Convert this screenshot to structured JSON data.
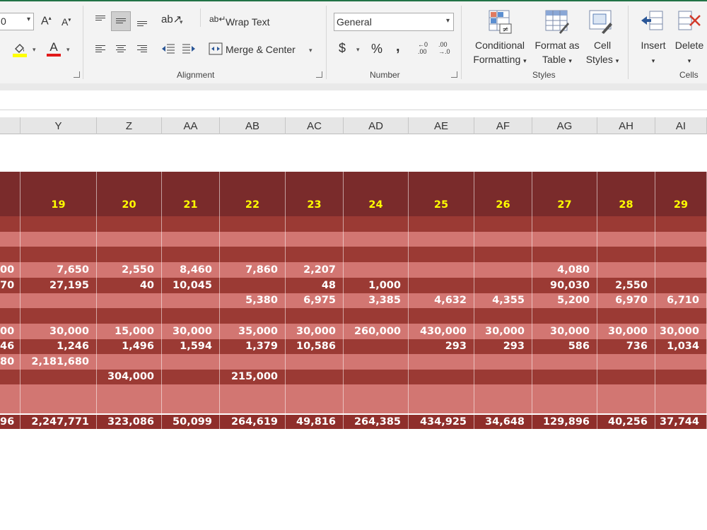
{
  "ribbon": {
    "font_size_value": "0",
    "wrap_text_label": "Wrap Text",
    "merge_center_label": "Merge & Center",
    "number_format_value": "General",
    "groups": {
      "alignment": "Alignment",
      "number": "Number",
      "styles": "Styles",
      "cells": "Cells"
    },
    "buttons": {
      "conditional_line1": "Conditional",
      "conditional_line2": "Formatting",
      "format_table_line1": "Format as",
      "format_table_line2": "Table",
      "cell_styles_line1": "Cell",
      "cell_styles_line2": "Styles",
      "insert": "Insert",
      "delete": "Delete"
    },
    "icons": {
      "grow_font": "A",
      "shrink_font": "A",
      "currency": "$",
      "percent": "%",
      "comma": ",",
      "increase_decimal_top": "←0",
      "increase_decimal_bottom": ".00",
      "decrease_decimal_top": ".00",
      "decrease_decimal_bottom": "→.0",
      "font_color": "A"
    }
  },
  "sheet": {
    "columns": [
      "Y",
      "Z",
      "AA",
      "AB",
      "AC",
      "AD",
      "AE",
      "AF",
      "AG",
      "AH",
      "AI"
    ],
    "header_days": [
      "",
      "19",
      "20",
      "21",
      "22",
      "23",
      "24",
      "25",
      "26",
      "27",
      "28",
      "29"
    ],
    "rows": [
      [
        "",
        "",
        "",
        "",
        "",
        "",
        "",
        "",
        "",
        "",
        "",
        ""
      ],
      [
        "",
        "",
        "",
        "",
        "",
        "",
        "",
        "",
        "",
        "",
        "",
        ""
      ],
      [
        "",
        "",
        "",
        "",
        "",
        "",
        "",
        "",
        "",
        "",
        "",
        ""
      ],
      [
        "00",
        "7,650",
        "2,550",
        "8,460",
        "7,860",
        "2,207",
        "",
        "",
        "",
        "4,080",
        "",
        ""
      ],
      [
        "70",
        "27,195",
        "40",
        "10,045",
        "",
        "48",
        "1,000",
        "",
        "",
        "90,030",
        "2,550",
        ""
      ],
      [
        "",
        "",
        "",
        "",
        "5,380",
        "6,975",
        "3,385",
        "4,632",
        "4,355",
        "5,200",
        "6,970",
        "6,710"
      ],
      [
        "",
        "",
        "",
        "",
        "",
        "",
        "",
        "",
        "",
        "",
        "",
        ""
      ],
      [
        "00",
        "30,000",
        "15,000",
        "30,000",
        "35,000",
        "30,000",
        "260,000",
        "430,000",
        "30,000",
        "30,000",
        "30,000",
        "30,000"
      ],
      [
        "46",
        "1,246",
        "1,496",
        "1,594",
        "1,379",
        "10,586",
        "",
        "293",
        "293",
        "586",
        "736",
        "1,034"
      ],
      [
        "80",
        "2,181,680",
        "",
        "",
        "",
        "",
        "",
        "",
        "",
        "",
        "",
        ""
      ],
      [
        "",
        "",
        "304,000",
        "",
        "215,000",
        "",
        "",
        "",
        "",
        "",
        "",
        ""
      ],
      [
        "",
        "",
        "",
        "",
        "",
        "",
        "",
        "",
        "",
        "",
        "",
        ""
      ]
    ],
    "totals": [
      "96",
      "2,247,771",
      "323,086",
      "50,099",
      "264,619",
      "49,816",
      "264,385",
      "434,925",
      "34,648",
      "129,896",
      "40,256",
      "37,744"
    ]
  }
}
